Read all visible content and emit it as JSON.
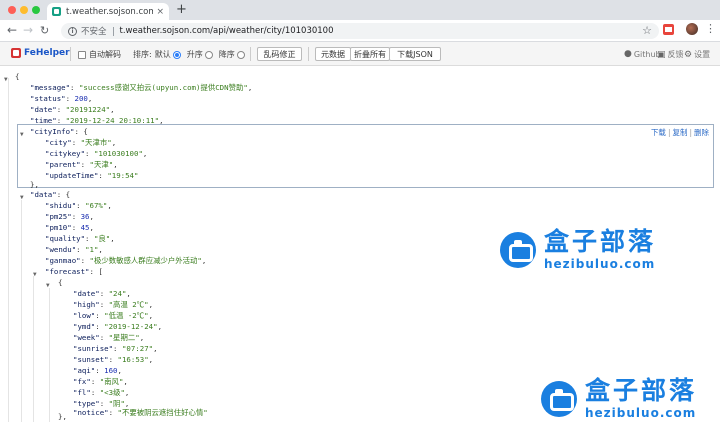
{
  "browser": {
    "tab_title": "t.weather.sojson.com/api/weat",
    "tab_close": "×",
    "new_tab": "+",
    "security_label": "不安全",
    "url": "t.weather.sojson.com/api/weather/city/101030100"
  },
  "fehelper": {
    "logo": "FeHelper",
    "auto_decode": "自动解码",
    "sort_label": "排序:",
    "sort_options": [
      "默认",
      "升序",
      "降序"
    ],
    "sort_selected": "默认",
    "fix_button": "乱码修正",
    "buttons": [
      "元数据",
      "折叠所有",
      "下载JSON"
    ],
    "github": "Github",
    "feedback": "反馈",
    "settings": "设置"
  },
  "json": {
    "open_brace": "{",
    "message_key": "\"message\"",
    "message_val": "\"success感谢又拍云(upyun.com)提供CDN赞助\"",
    "status_key": "\"status\"",
    "status_val": "200",
    "date_key": "\"date\"",
    "date_val": "\"20191224\"",
    "time_key": "\"time\"",
    "time_val": "\"2019-12-24 20:10:11\"",
    "cityinfo_key": "\"cityInfo\"",
    "city_key": "\"city\"",
    "city_val": "\"天津市\"",
    "citykey_key": "\"citykey\"",
    "citykey_val": "\"101030100\"",
    "parent_key": "\"parent\"",
    "parent_val": "\"天津\"",
    "updatetime_key": "\"updateTime\"",
    "updatetime_val": "\"19:54\"",
    "city_actions": [
      "下载",
      "复制",
      "删除"
    ],
    "data_key": "\"data\"",
    "shidu_key": "\"shidu\"",
    "shidu_val": "\"67%\"",
    "pm25_key": "\"pm25\"",
    "pm25_val": "36",
    "pm10_key": "\"pm10\"",
    "pm10_val": "45",
    "quality_key": "\"quality\"",
    "quality_val": "\"良\"",
    "wendu_key": "\"wendu\"",
    "wendu_val": "\"1\"",
    "ganmao_key": "\"ganmao\"",
    "ganmao_val": "\"极少数敏感人群应减少户外活动\"",
    "forecast_key": "\"forecast\"",
    "f_date_key": "\"date\"",
    "f_date_val": "\"24\"",
    "f_high_key": "\"high\"",
    "f_high_val": "\"高温 2℃\"",
    "f_low_key": "\"low\"",
    "f_low_val": "\"低温 -2℃\"",
    "f_ymd_key": "\"ymd\"",
    "f_ymd_val": "\"2019-12-24\"",
    "f_week_key": "\"week\"",
    "f_week_val": "\"星期二\"",
    "f_sunrise_key": "\"sunrise\"",
    "f_sunrise_val": "\"07:27\"",
    "f_sunset_key": "\"sunset\"",
    "f_sunset_val": "\"16:53\"",
    "f_aqi_key": "\"aqi\"",
    "f_aqi_val": "160",
    "f_fx_key": "\"fx\"",
    "f_fx_val": "\"南风\"",
    "f_fl_key": "\"fl\"",
    "f_fl_val": "\"<3级\"",
    "f_type_key": "\"type\"",
    "f_type_val": "\"阴\"",
    "f_notice_key": "\"notice\"",
    "f_notice_val": "\"不要被阴云遮挡住好心情\""
  },
  "watermark": {
    "cn": "盒子部落",
    "en": "hezibuluo.com"
  },
  "colors": {
    "json_key": "#0b1d5a",
    "json_string": "#3a7d1e",
    "json_number": "#1a2eb0",
    "watermark": "#1a7fe0"
  }
}
